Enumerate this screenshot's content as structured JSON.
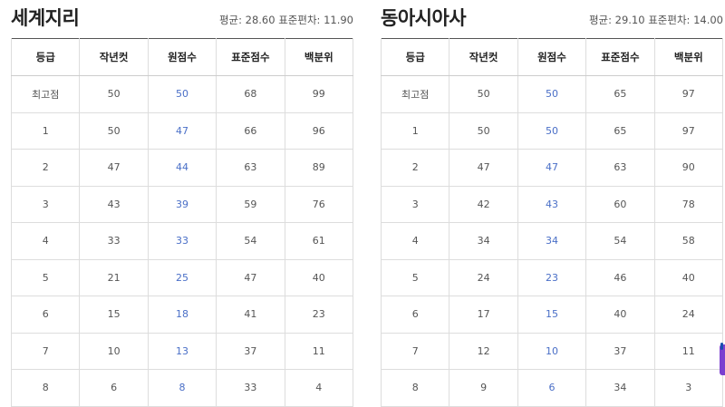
{
  "columns": [
    "등급",
    "작년컷",
    "원점수",
    "표준점수",
    "백분위"
  ],
  "panels": [
    {
      "title": "세계지리",
      "stats": "평균: 28.60 표준편차: 11.90",
      "rows": [
        [
          "최고점",
          "50",
          "50",
          "68",
          "99"
        ],
        [
          "1",
          "50",
          "47",
          "66",
          "96"
        ],
        [
          "2",
          "47",
          "44",
          "63",
          "89"
        ],
        [
          "3",
          "43",
          "39",
          "59",
          "76"
        ],
        [
          "4",
          "33",
          "33",
          "54",
          "61"
        ],
        [
          "5",
          "21",
          "25",
          "47",
          "40"
        ],
        [
          "6",
          "15",
          "18",
          "41",
          "23"
        ],
        [
          "7",
          "10",
          "13",
          "37",
          "11"
        ],
        [
          "8",
          "6",
          "8",
          "33",
          "4"
        ]
      ]
    },
    {
      "title": "동아시아사",
      "stats": "평균: 29.10 표준편차: 14.00",
      "rows": [
        [
          "최고점",
          "50",
          "50",
          "65",
          "97"
        ],
        [
          "1",
          "50",
          "50",
          "65",
          "97"
        ],
        [
          "2",
          "47",
          "47",
          "63",
          "90"
        ],
        [
          "3",
          "42",
          "43",
          "60",
          "78"
        ],
        [
          "4",
          "34",
          "34",
          "54",
          "58"
        ],
        [
          "5",
          "24",
          "23",
          "46",
          "40"
        ],
        [
          "6",
          "17",
          "15",
          "40",
          "24"
        ],
        [
          "7",
          "12",
          "10",
          "37",
          "11"
        ],
        [
          "8",
          "9",
          "6",
          "34",
          "3"
        ]
      ]
    }
  ]
}
